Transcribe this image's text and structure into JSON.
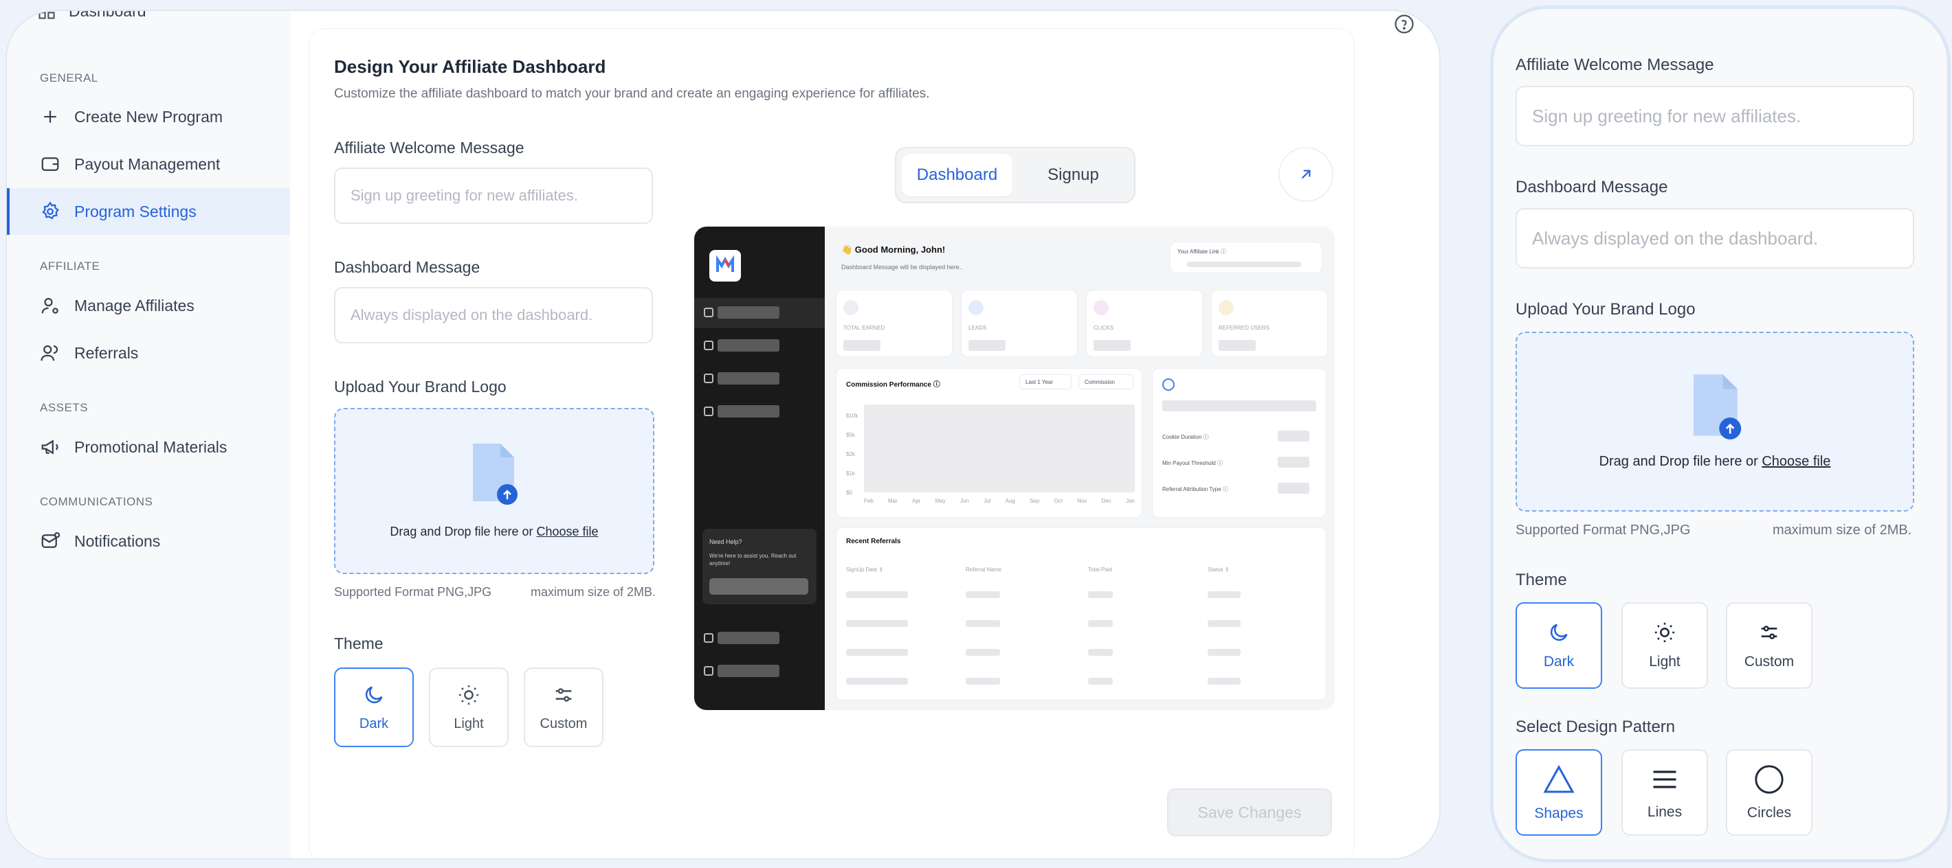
{
  "sidebar": {
    "top_item": "Dashboard",
    "sections": [
      {
        "title": "GENERAL",
        "items": [
          "Create New Program",
          "Payout Management",
          "Program Settings"
        ]
      },
      {
        "title": "AFFILIATE",
        "items": [
          "Manage Affiliates",
          "Referrals"
        ]
      },
      {
        "title": "ASSETS",
        "items": [
          "Promotional Materials"
        ]
      },
      {
        "title": "COMMUNICATIONS",
        "items": [
          "Notifications"
        ]
      }
    ],
    "active": "Program Settings"
  },
  "main": {
    "title": "Design Your Affiliate Dashboard",
    "subtitle": "Customize the affiliate dashboard to match your brand and create an engaging experience for affiliates.",
    "welcome_label": "Affiliate Welcome Message",
    "welcome_placeholder": "Sign up greeting for new affiliates.",
    "dashboard_msg_label": "Dashboard Message",
    "dashboard_msg_placeholder": "Always displayed on the dashboard.",
    "logo_label": "Upload Your Brand Logo",
    "drop_text": "Drag and Drop file here or ",
    "choose_file": "Choose file",
    "supported": "Supported Format PNG,JPG",
    "max_size": "maximum size of 2MB.",
    "theme_label": "Theme",
    "themes": [
      "Dark",
      "Light",
      "Custom"
    ],
    "selected_theme": "Dark",
    "save_label": "Save Changes"
  },
  "preview": {
    "tabs": [
      "Dashboard",
      "Signup"
    ],
    "active_tab": "Dashboard",
    "greeting": "👋 Good Morning, John!",
    "greeting_sub": "Dashboard Message will be displayed here..",
    "affiliate_link": "Your Affiliate Link ⓘ",
    "stats": [
      "TOTAL EARNED",
      "LEADS",
      "CLICKS",
      "REFERRED USERS"
    ],
    "perf_title": "Commission Performance ⓘ",
    "perf_range": "Last 1 Year",
    "perf_metric": "Commission",
    "y_ticks": [
      "$10k",
      "$5k",
      "$2k",
      "$1k",
      "$0"
    ],
    "months": [
      "Feb",
      "Mar",
      "Apr",
      "May",
      "Jun",
      "Jul",
      "Aug",
      "Sep",
      "Oct",
      "Nov",
      "Dec",
      "Jan"
    ],
    "settings": [
      "Cookie Duration ⓘ",
      "Min Payout Threshold ⓘ",
      "Referral Attribution Type ⓘ"
    ],
    "referrals_title": "Recent Referrals",
    "ref_cols": [
      "SignUp Date ⇕",
      "Referral Name",
      "Total Paid",
      "Status ⇕"
    ],
    "help_title": "Need Help?",
    "help_text": "We're here to assist you. Reach out anytime!"
  },
  "right_panel": {
    "welcome_label": "Affiliate Welcome Message",
    "welcome_placeholder": "Sign up greeting for new affiliates.",
    "dashboard_msg_label": "Dashboard Message",
    "dashboard_msg_placeholder": "Always displayed on the dashboard.",
    "logo_label": "Upload Your Brand Logo",
    "drop_text": "Drag and Drop file here or ",
    "choose_file": "Choose file",
    "supported": "Supported Format PNG,JPG",
    "max_size": "maximum size of 2MB.",
    "theme_label": "Theme",
    "themes": [
      "Dark",
      "Light",
      "Custom"
    ],
    "pattern_label": "Select Design Pattern",
    "patterns": [
      "Shapes",
      "Lines",
      "Circles"
    ],
    "selected_pattern": "Shapes"
  },
  "colors": {
    "accent": "#2563d9",
    "active_bg": "#e8f0fc",
    "drop_bg": "#eef4fd",
    "preview_sidebar": "#1a1a1a"
  }
}
